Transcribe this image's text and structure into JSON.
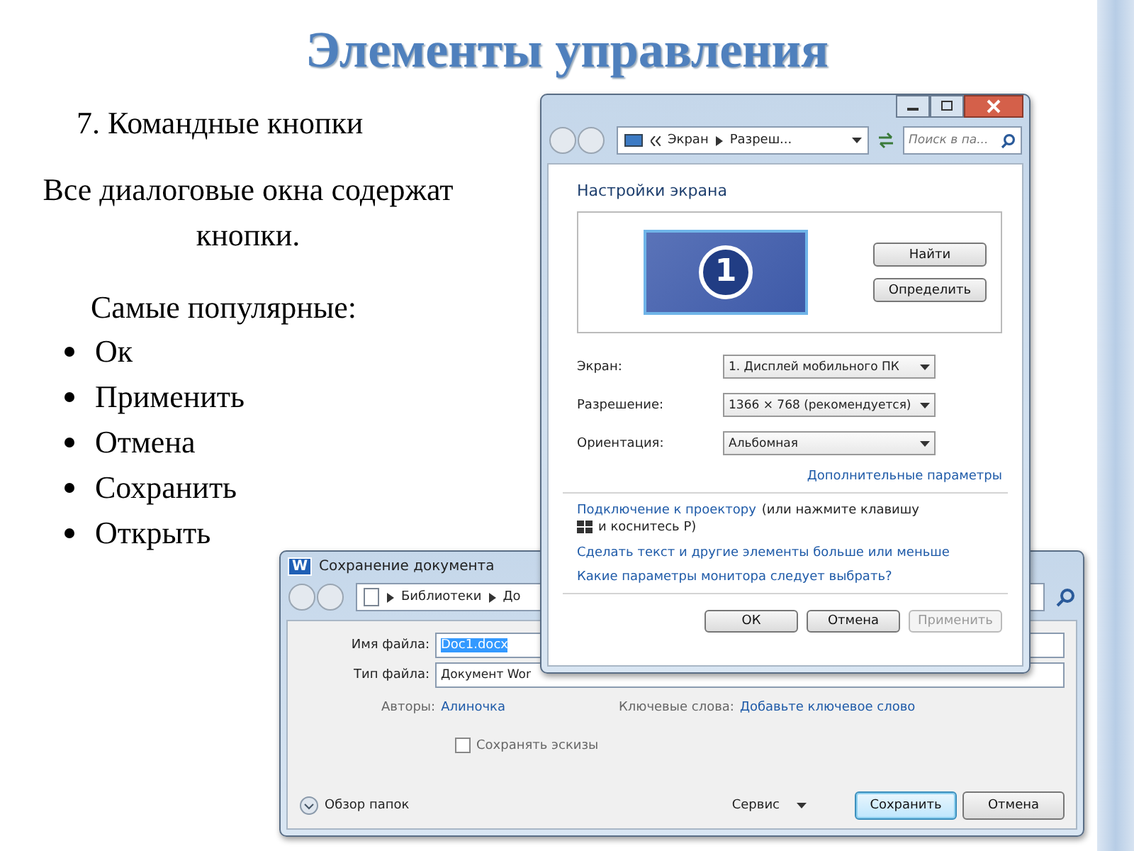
{
  "slide": {
    "title": "Элементы управления",
    "heading": "7. Командные кнопки",
    "intro": "Все диалоговые окна содержат кнопки.",
    "list_title": "Самые популярные:",
    "bullets": [
      "Ок",
      "Применить",
      "Отмена",
      "Сохранить",
      "Открыть"
    ]
  },
  "save_dialog": {
    "title": "Сохранение документа",
    "app_letter": "W",
    "breadcrumb": [
      "Библиотеки",
      "До"
    ],
    "fields": [
      {
        "label": "Имя файла:",
        "value": "Doc1.docx",
        "kind": "input"
      },
      {
        "label": "Тип файла:",
        "value": "Документ Wor",
        "kind": "select"
      }
    ],
    "authors_label": "Авторы:",
    "authors": "Алиночка",
    "keywords_label": "Ключевые слова:",
    "keywords": "Добавьте ключевое слово",
    "thumbnails": {
      "label": "Сохранять эскизы",
      "checked": false
    },
    "browse": "Обзор папок",
    "tools": "Сервис",
    "buttons": [
      {
        "label": "Сохранить",
        "default": true
      },
      {
        "label": "Отмена",
        "default": false
      }
    ]
  },
  "display_window": {
    "breadcrumb": [
      "Экран",
      "Разреш..."
    ],
    "search": {
      "placeholder": "Поиск в па..."
    },
    "heading": "Настройки экрана",
    "monitor_number": "1",
    "side_buttons": [
      "Найти",
      "Определить"
    ],
    "settings": [
      {
        "label": "Экран:",
        "value": "1. Дисплей мобильного ПК"
      },
      {
        "label": "Разрешение:",
        "value": "1366 × 768 (рекомендуется)"
      },
      {
        "label": "Ориентация:",
        "value": "Альбомная"
      }
    ],
    "advanced_link": "Дополнительные параметры",
    "projector_link": "Подключение к проектору",
    "projector_note": "(или нажмите клавишу",
    "projector_note_end": "и коснитесь P)",
    "links": [
      "Сделать текст и другие элементы больше или меньше",
      "Какие параметры монитора следует выбрать?"
    ],
    "buttons": [
      {
        "label": "ОК",
        "disabled": false
      },
      {
        "label": "Отмена",
        "disabled": false
      },
      {
        "label": "Применить",
        "disabled": true
      }
    ]
  }
}
